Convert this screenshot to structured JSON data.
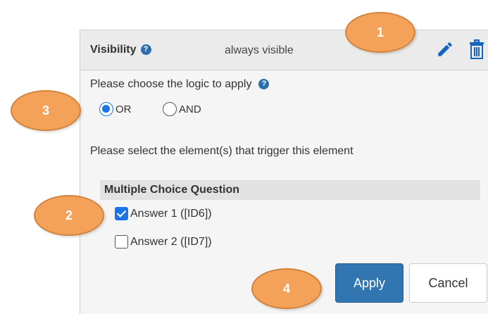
{
  "visibility": {
    "label": "Visibility",
    "help_icon": "question-circle-icon",
    "value": "always visible",
    "edit_icon": "pencil-icon",
    "delete_icon": "trash-icon"
  },
  "logic": {
    "title": "Please choose the logic to apply",
    "help_icon": "question-circle-icon",
    "options": [
      {
        "label": "OR",
        "selected": true
      },
      {
        "label": "AND",
        "selected": false
      }
    ]
  },
  "trigger": {
    "title": "Please select the element(s) that trigger this element",
    "group_title": "Multiple Choice Question",
    "answers": [
      {
        "label": "Answer 1 ([ID6])",
        "checked": true
      },
      {
        "label": "Answer 2 ([ID7])",
        "checked": false
      }
    ]
  },
  "buttons": {
    "apply": "Apply",
    "cancel": "Cancel"
  },
  "markers": [
    "1",
    "2",
    "3",
    "4"
  ],
  "colors": {
    "accent": "#1a73e8",
    "apply_button": "#3276b1",
    "help_icon": "#2a6eb0",
    "marker_fill": "#f4a259"
  }
}
